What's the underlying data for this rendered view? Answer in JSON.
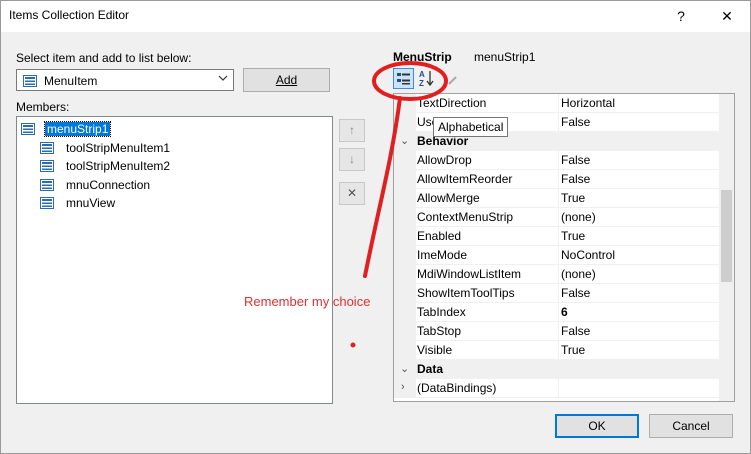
{
  "window": {
    "title": "Items Collection Editor",
    "help_glyph": "?",
    "close_glyph": "✕"
  },
  "left": {
    "select_label": "Select item and add to list below:",
    "select_mnemonic_note": "S",
    "combo_value": "MenuItem",
    "add_label": "Add",
    "members_label": "Members:",
    "members": [
      {
        "label": "menuStrip1",
        "selected": true
      },
      {
        "label": "toolStripMenuItem1"
      },
      {
        "label": "toolStripMenuItem2"
      },
      {
        "label": "mnuConnection"
      },
      {
        "label": "mnuView"
      }
    ]
  },
  "side_buttons": {
    "up_glyph": "↑",
    "down_glyph": "↓",
    "delete_glyph": "✕"
  },
  "properties": {
    "object_type": "MenuStrip",
    "object_name": "menuStrip1",
    "tooltip": "Alphabetical",
    "rows": [
      {
        "name": "TextDirection",
        "value": "Horizontal"
      },
      {
        "name": "Use",
        "value": "False"
      },
      {
        "name": "Behavior",
        "category": true
      },
      {
        "name": "AllowDrop",
        "value": "False"
      },
      {
        "name": "AllowItemReorder",
        "value": "False"
      },
      {
        "name": "AllowMerge",
        "value": "True"
      },
      {
        "name": "ContextMenuStrip",
        "value": "(none)"
      },
      {
        "name": "Enabled",
        "value": "True"
      },
      {
        "name": "ImeMode",
        "value": "NoControl"
      },
      {
        "name": "MdiWindowListItem",
        "value": "(none)"
      },
      {
        "name": "ShowItemToolTips",
        "value": "False"
      },
      {
        "name": "TabIndex",
        "value": "6",
        "bold": true
      },
      {
        "name": "TabStop",
        "value": "False"
      },
      {
        "name": "Visible",
        "value": "True"
      },
      {
        "name": "Data",
        "category": true
      },
      {
        "name": "(DataBindings)",
        "value": "",
        "expandable": true
      }
    ]
  },
  "footer": {
    "ok_label": "OK",
    "cancel_label": "Cancel"
  },
  "annotation": {
    "text": "Remember my choice",
    "color": "#e03030"
  }
}
